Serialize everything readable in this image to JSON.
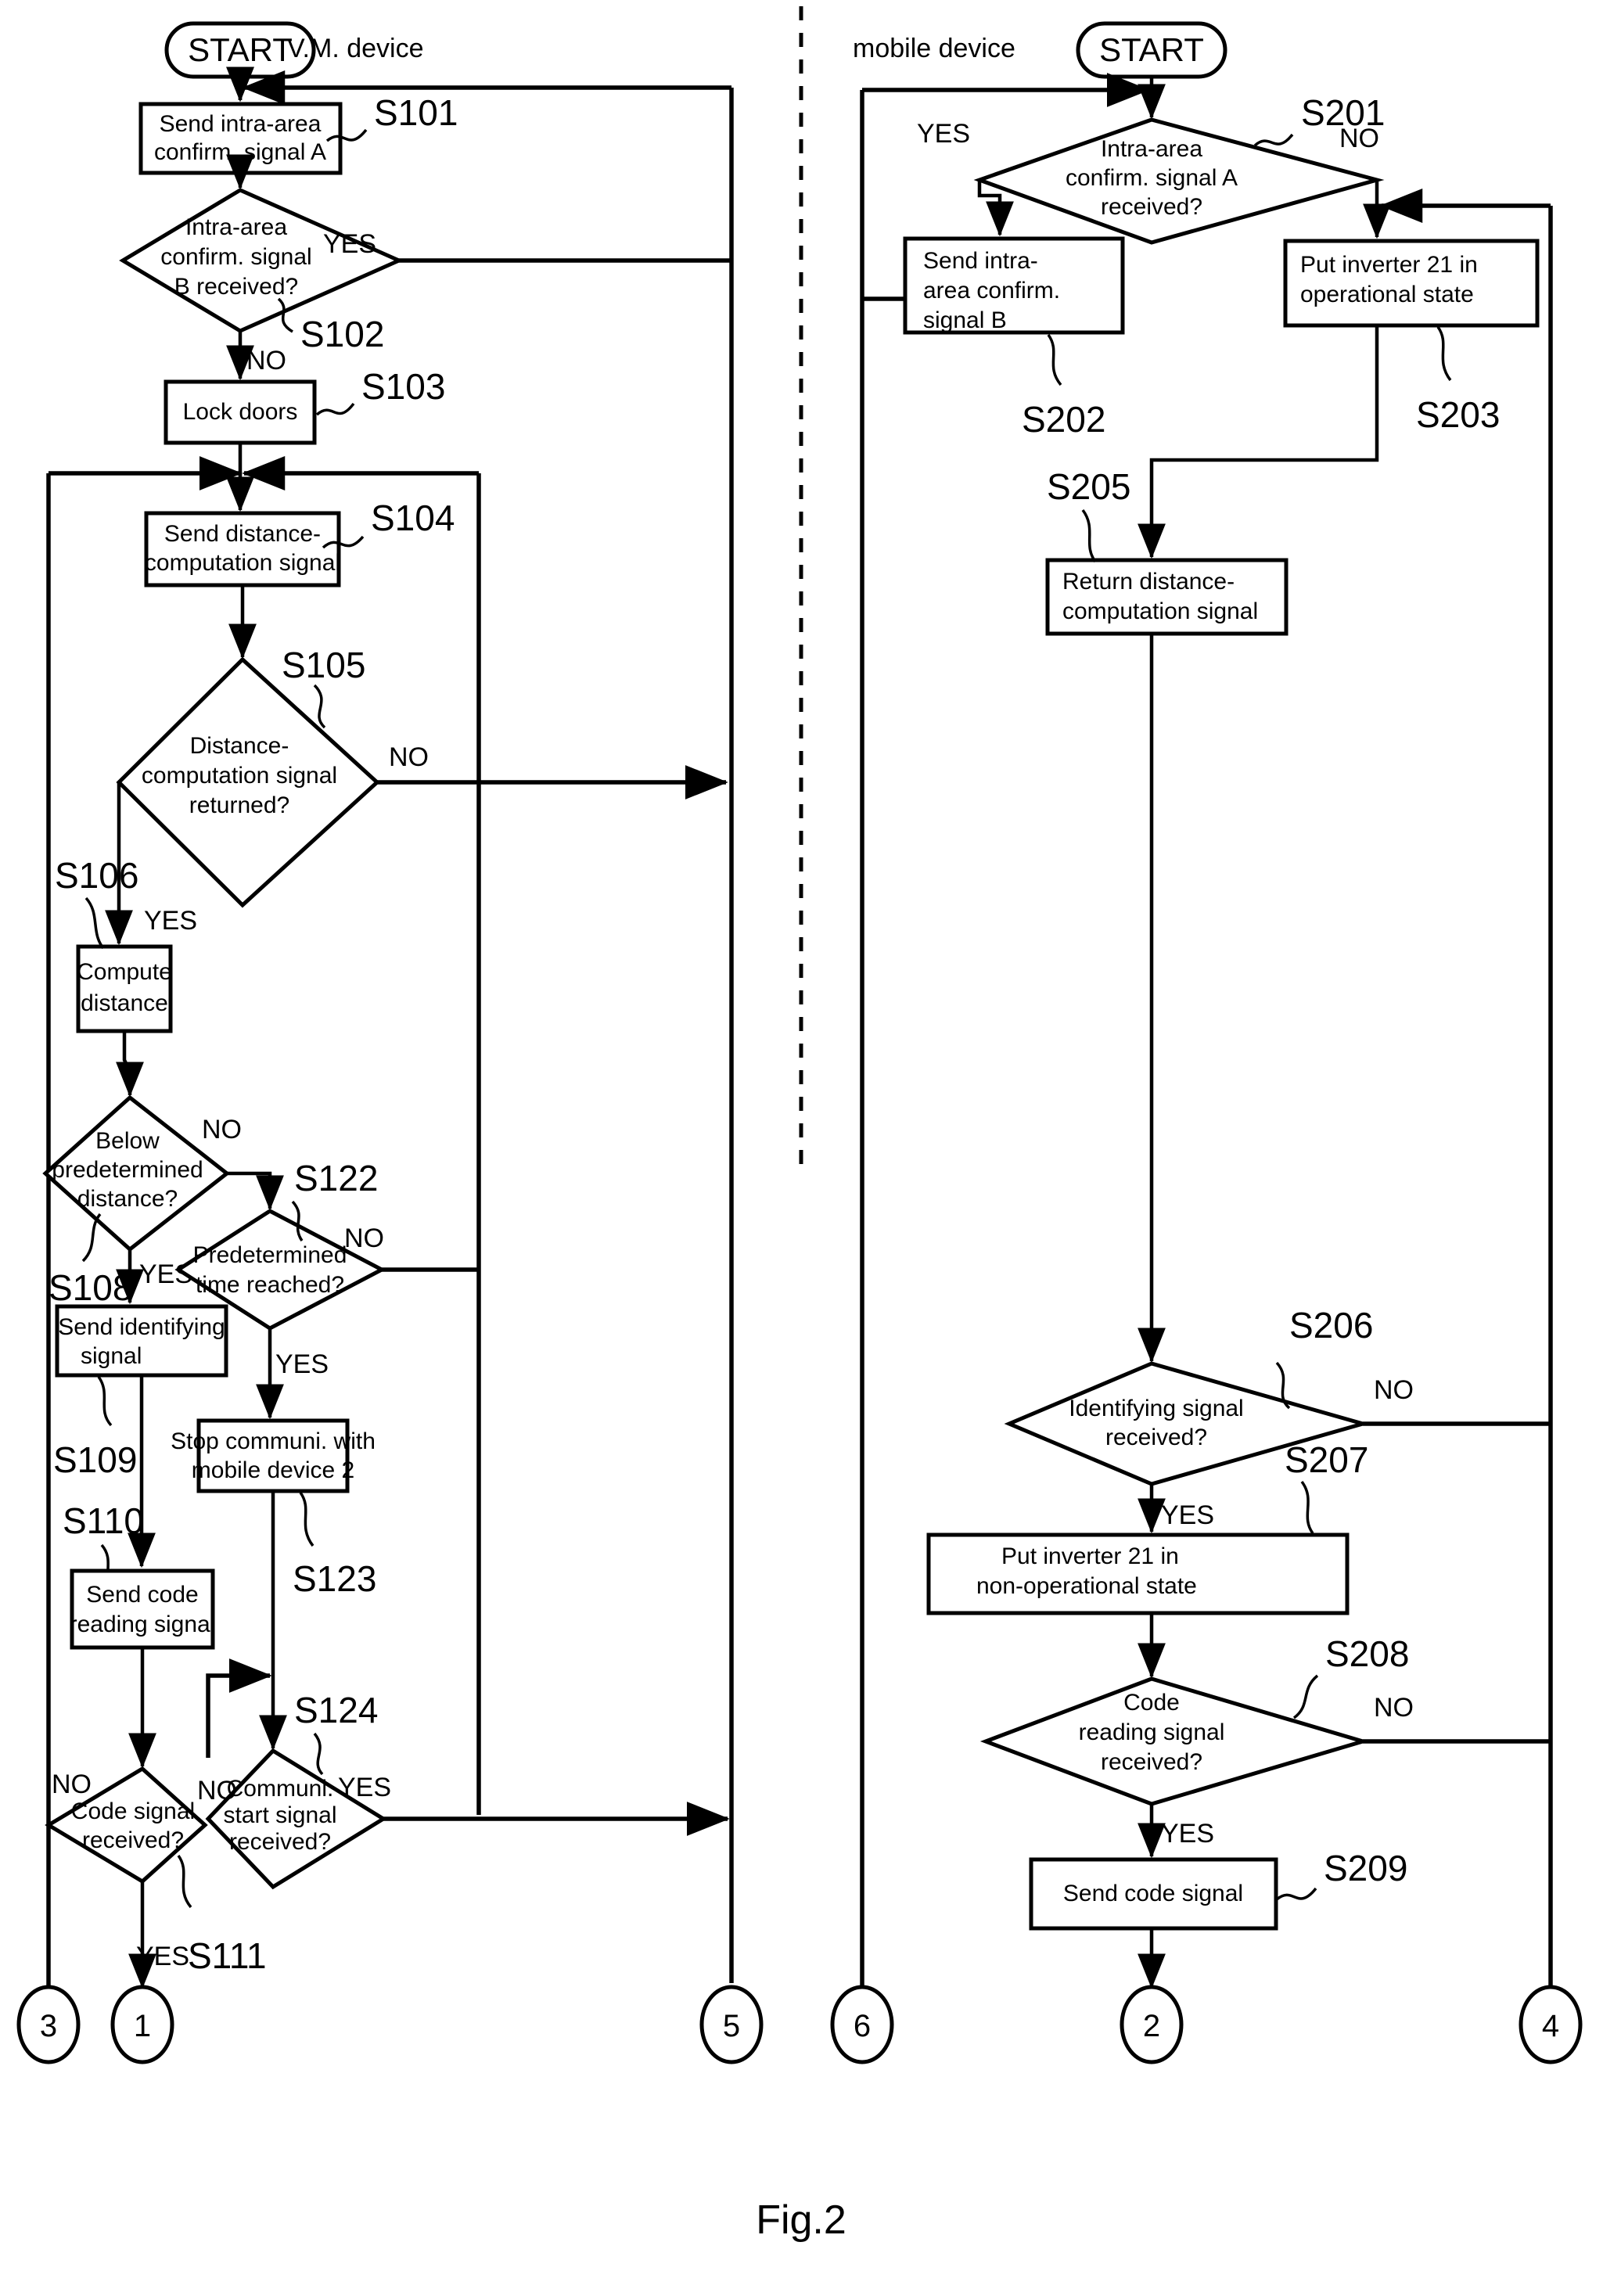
{
  "figure": {
    "caption": "Fig.2"
  },
  "lanes": {
    "left_label": "V.M. device",
    "right_label": "mobile device"
  },
  "terminals": {
    "start_left": "START",
    "start_right": "START"
  },
  "left_flow": {
    "nodes": [
      {
        "id": "S101",
        "tag": "S101",
        "kind": "process",
        "lines": [
          "Send intra-area",
          "confirm. signal A"
        ]
      },
      {
        "id": "S102",
        "tag": "S102",
        "kind": "decision",
        "lines": [
          "Intra-area",
          "confirm. signal",
          "B received?"
        ]
      },
      {
        "id": "S103",
        "tag": "S103",
        "kind": "process",
        "lines": [
          "Lock doors"
        ]
      },
      {
        "id": "S104",
        "tag": "S104",
        "kind": "process",
        "lines": [
          "Send distance-",
          "computation signal"
        ]
      },
      {
        "id": "S105",
        "tag": "S105",
        "kind": "decision",
        "lines": [
          "Distance-",
          "computation signal",
          "returned?"
        ]
      },
      {
        "id": "S106",
        "tag": "S106",
        "kind": "process",
        "lines": [
          "Compute",
          "distance"
        ]
      },
      {
        "id": "S107",
        "tag": "S108",
        "kind": "decision",
        "lines": [
          "Below",
          "predetermined",
          "distance?"
        ]
      },
      {
        "id": "S108",
        "tag": "S109",
        "kind": "process",
        "lines": [
          "Send identifying",
          "signal"
        ]
      },
      {
        "id": "S110",
        "tag": "S110",
        "kind": "process",
        "lines": [
          "Send code",
          "reading signal"
        ]
      },
      {
        "id": "S111",
        "tag": "S111",
        "kind": "decision",
        "lines": [
          "Code signal",
          "received?"
        ]
      },
      {
        "id": "S122",
        "tag": "S122",
        "kind": "decision",
        "lines": [
          "Predetermined",
          "time reached?"
        ]
      },
      {
        "id": "S123",
        "tag": "S123",
        "kind": "process",
        "lines": [
          "Stop communi. with",
          "mobile device 2"
        ]
      },
      {
        "id": "S124",
        "tag": "S124",
        "kind": "decision",
        "lines": [
          "Communi.",
          "start signal",
          "received?"
        ]
      }
    ],
    "connectors": [
      {
        "id": "c3",
        "label": "3"
      },
      {
        "id": "c1",
        "label": "1"
      },
      {
        "id": "c5",
        "label": "5"
      }
    ]
  },
  "right_flow": {
    "nodes": [
      {
        "id": "S201",
        "tag": "S201",
        "kind": "decision",
        "lines": [
          "Intra-area",
          "confirm. signal A",
          "received?"
        ]
      },
      {
        "id": "S202",
        "tag": "S202",
        "kind": "process",
        "lines": [
          "Send intra-",
          "area confirm.",
          "signal B"
        ]
      },
      {
        "id": "S203",
        "tag": "S203",
        "kind": "process",
        "lines": [
          "Put inverter 21 in",
          "operational state"
        ]
      },
      {
        "id": "S205",
        "tag": "S205",
        "kind": "process",
        "lines": [
          "Return distance-",
          "computation signal"
        ]
      },
      {
        "id": "S206",
        "tag": "S206",
        "kind": "decision",
        "lines": [
          "Identifying signal",
          "received?"
        ]
      },
      {
        "id": "S207",
        "tag": "S207",
        "kind": "process",
        "lines": [
          "Put inverter 21 in",
          "non-operational state"
        ]
      },
      {
        "id": "S208",
        "tag": "S208",
        "kind": "decision",
        "lines": [
          "Code",
          "reading signal",
          "received?"
        ]
      },
      {
        "id": "S209",
        "tag": "S209",
        "kind": "process",
        "lines": [
          "Send code signal"
        ]
      }
    ],
    "connectors": [
      {
        "id": "c6",
        "label": "6"
      },
      {
        "id": "c2",
        "label": "2"
      },
      {
        "id": "c4",
        "label": "4"
      }
    ]
  },
  "branch_labels": {
    "yes": "YES",
    "no": "NO"
  },
  "colors": {
    "stroke": "#000000",
    "fill": "#ffffff",
    "background": "#ffffff"
  }
}
